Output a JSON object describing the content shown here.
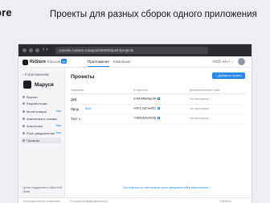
{
  "page": {
    "brand_fragment": "ore",
    "headline": "Проекты для разных сборок одного приложения"
  },
  "browser": {
    "url": "console.rustore.ru/apps/000000/push/projects"
  },
  "topnav": {
    "logo": "RuStore",
    "console": "Консоль",
    "ui_tag": "UI",
    "tabs": [
      "Приложения",
      "Компания"
    ],
    "active_tab": 0,
    "user": "ООО «Ис» ⌄"
  },
  "sidebar": {
    "back": "К приложениям",
    "app_name": "Маруся",
    "items": [
      {
        "label": "Версии",
        "badge": ""
      },
      {
        "label": "Разработчики",
        "badge": ""
      },
      {
        "label": "Монетизация",
        "badge": "Beta"
      },
      {
        "label": "Аналитика и отзывы",
        "badge": ""
      },
      {
        "label": "Аналитика",
        "badge": "Beta"
      },
      {
        "label": "Push-уведомления",
        "badge": "Beta"
      },
      {
        "label": "Проекты",
        "badge": ""
      }
    ],
    "footer": [
      "Центр поддержки и обратной",
      "связи"
    ]
  },
  "main": {
    "title": "Проекты",
    "add_button": "+ Добавить проект",
    "columns": [
      "Название",
      "ID проекта",
      "Дополнительные поля"
    ],
    "rows": [
      {
        "name": "Дев",
        "badge": "",
        "id": "2xKh8Nw9ap3m",
        "notes": "Не настроено"
      },
      {
        "name": "Прод",
        "badge": "Beta",
        "id": "xmF3Jq5nw2Nz",
        "notes": "Не настроено"
      },
      {
        "name": "Тест 1",
        "badge": "",
        "id": "rHD9eN2whk8Q",
        "notes": "Не настроено"
      }
    ],
    "instructions": "Инструкция по интеграции push-уведомлений в приложение ›"
  },
  "footer": {
    "items": [
      "Пользовательское соглашение",
      "Политика конфиденциальности",
      "© RuStore"
    ]
  },
  "colors": {
    "accent": "#2688eb",
    "background": "#edeef2",
    "chrome": "#2b2c31"
  }
}
